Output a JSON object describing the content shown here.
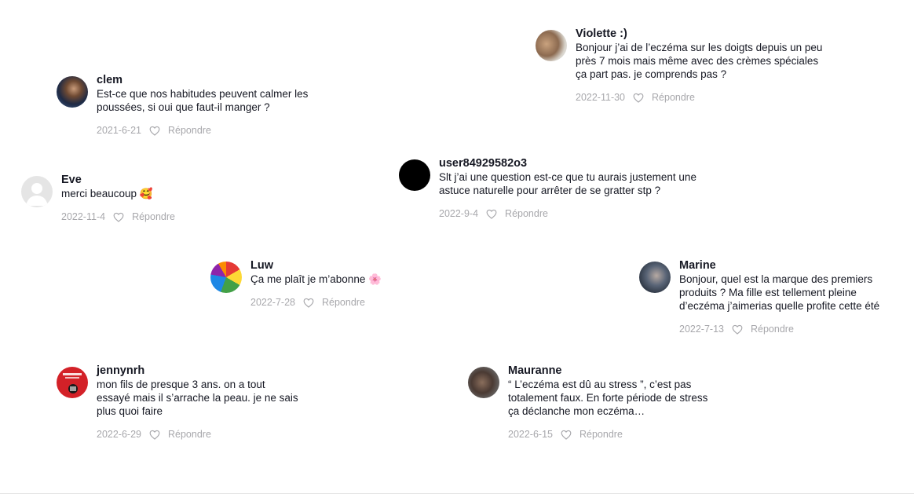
{
  "comments": [
    {
      "id": "violette",
      "username": "Violette :)",
      "text": "Bonjour j’ai de l’eczéma sur les doigts depuis un peu\nprès 7 mois mais même avec des crèmes spéciales\nça part pas. je comprends pas ?",
      "date": "2022-11-30",
      "reply": "Répondre",
      "avatar": "photo-avatar"
    },
    {
      "id": "clem",
      "username": "clem",
      "text": "Est-ce que nos habitudes peuvent calmer les\npoussées, si oui que faut-il manger ?",
      "date": "2021-6-21",
      "reply": "Répondre",
      "avatar": "photo-avatar"
    },
    {
      "id": "user",
      "username": "user84929582o3",
      "text": "Slt j’ai une question est-ce que tu aurais justement une\nastuce naturelle pour arrêter de se gratter stp ?",
      "date": "2022-9-4",
      "reply": "Répondre",
      "avatar": "black-avatar"
    },
    {
      "id": "eve",
      "username": "Eve",
      "text": "merci beaucoup 🥰",
      "date": "2022-11-4",
      "reply": "Répondre",
      "avatar": "default-user-avatar"
    },
    {
      "id": "luw",
      "username": "Luw",
      "text": "Ça me plaît je m’abonne 🌸",
      "date": "2022-7-28",
      "reply": "Répondre",
      "avatar": "globe-avatar"
    },
    {
      "id": "marine",
      "username": "Marine",
      "text": "Bonjour, quel est la marque des premiers\nproduits ? Ma fille est tellement pleine\nd’eczéma j’aimerias quelle profite cette été",
      "date": "2022-7-13",
      "reply": "Répondre",
      "avatar": "photo-avatar"
    },
    {
      "id": "jenny",
      "username": "jennynrh",
      "text": "mon fils de presque 3 ans. on a tout\nessayé mais il s’arrache la peau. je ne sais\nplus quoi faire",
      "date": "2022-6-29",
      "reply": "Répondre",
      "avatar": "red-poster-avatar"
    },
    {
      "id": "mauranne",
      "username": "Mauranne",
      "text": "“ L’eczéma est dû au stress ”, c’est pas\ntotalement faux. En forte période de stress\nça déclanche mon eczéma…",
      "date": "2022-6-15",
      "reply": "Répondre",
      "avatar": "photo-avatar"
    }
  ],
  "icons": {
    "like": "heart-outline-icon"
  },
  "colors": {
    "text": "#161823",
    "meta": "#a7a7ab",
    "background": "#ffffff"
  }
}
